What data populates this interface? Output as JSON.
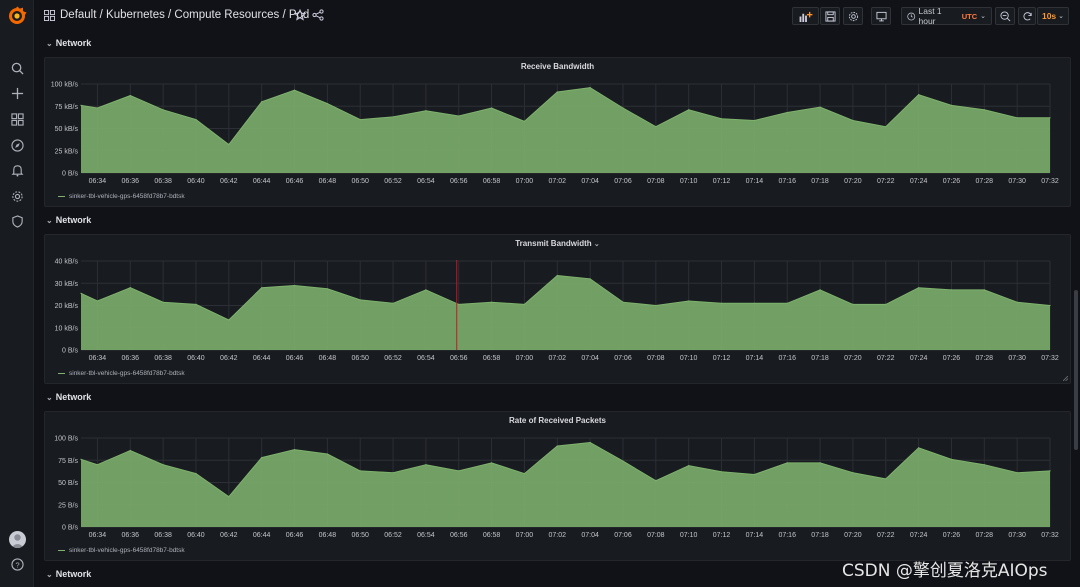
{
  "nav": {
    "breadcrumb": "Default / Kubernetes / Compute Resources / Pod"
  },
  "sidebar": {
    "items": [
      "search-icon",
      "plus-icon",
      "dashboards-icon",
      "explore-icon",
      "alerting-icon",
      "configuration-icon",
      "shield-icon"
    ],
    "bottom": [
      "user-avatar",
      "help-icon"
    ]
  },
  "toolbar": {
    "time_range": "Last 1 hour",
    "timezone": "UTC",
    "refresh_interval": "10s"
  },
  "rows": [
    {
      "title": "Network"
    },
    {
      "title": "Network"
    },
    {
      "title": "Network"
    },
    {
      "title": "Network"
    }
  ],
  "panels": [
    {
      "title": "Receive Bandwidth",
      "legend": "sinker-tbl-vehicle-gps-6458fd78b7-bdtsk",
      "y_ticks": [
        "100 kB/s",
        "75 kB/s",
        "50 kB/s",
        "25 kB/s",
        "0 B/s"
      ]
    },
    {
      "title": "Transmit Bandwidth",
      "legend": "sinker-tbl-vehicle-gps-6458fd78b7-bdtsk",
      "y_ticks": [
        "40 kB/s",
        "30 kB/s",
        "20 kB/s",
        "10 kB/s",
        "0 B/s"
      ]
    },
    {
      "title": "Rate of Received Packets",
      "legend": "sinker-tbl-vehicle-gps-6458fd78b7-bdtsk",
      "y_ticks": [
        "100 B/s",
        "75 B/s",
        "50 B/s",
        "25 B/s",
        "0 B/s"
      ]
    }
  ],
  "colors": {
    "series_fill": "#7eb26d",
    "cursor_line": "#c4162a",
    "timezone": "#ff7941",
    "refresh": "#ff9830"
  },
  "chart_data": [
    {
      "type": "area",
      "title": "Receive Bandwidth",
      "x": [
        "06:33",
        "06:34",
        "06:36",
        "06:38",
        "06:40",
        "06:42",
        "06:44",
        "06:46",
        "06:48",
        "06:50",
        "06:52",
        "06:54",
        "06:56",
        "06:58",
        "07:00",
        "07:02",
        "07:04",
        "07:06",
        "07:08",
        "07:10",
        "07:12",
        "07:14",
        "07:16",
        "07:18",
        "07:20",
        "07:22",
        "07:24",
        "07:26",
        "07:28",
        "07:30",
        "07:32"
      ],
      "x_ticks": [
        "06:34",
        "06:36",
        "06:38",
        "06:40",
        "06:42",
        "06:44",
        "06:46",
        "06:48",
        "06:50",
        "06:52",
        "06:54",
        "06:56",
        "06:58",
        "07:00",
        "07:02",
        "07:04",
        "07:06",
        "07:08",
        "07:10",
        "07:12",
        "07:14",
        "07:16",
        "07:18",
        "07:20",
        "07:22",
        "07:24",
        "07:26",
        "07:28",
        "07:30",
        "07:32"
      ],
      "series": [
        {
          "name": "sinker-tbl-vehicle-gps-6458fd78b7-bdtsk",
          "values": [
            76,
            73,
            87,
            71,
            60,
            32,
            80,
            93,
            78,
            60,
            63,
            70,
            64,
            73,
            58,
            91,
            96,
            73,
            52,
            71,
            61,
            59,
            68,
            74,
            59,
            52,
            88,
            76,
            71,
            62,
            62
          ]
        }
      ],
      "ylim": [
        0,
        100
      ],
      "y_unit": "kB/s"
    },
    {
      "type": "area",
      "title": "Transmit Bandwidth",
      "x": [
        "06:33",
        "06:34",
        "06:36",
        "06:38",
        "06:40",
        "06:42",
        "06:44",
        "06:46",
        "06:48",
        "06:50",
        "06:52",
        "06:54",
        "06:56",
        "06:58",
        "07:00",
        "07:02",
        "07:04",
        "07:06",
        "07:08",
        "07:10",
        "07:12",
        "07:14",
        "07:16",
        "07:18",
        "07:20",
        "07:22",
        "07:24",
        "07:26",
        "07:28",
        "07:30",
        "07:32"
      ],
      "x_ticks": [
        "06:34",
        "06:36",
        "06:38",
        "06:40",
        "06:42",
        "06:44",
        "06:46",
        "06:48",
        "06:50",
        "06:52",
        "06:54",
        "06:56",
        "06:58",
        "07:00",
        "07:02",
        "07:04",
        "07:06",
        "07:08",
        "07:10",
        "07:12",
        "07:14",
        "07:16",
        "07:18",
        "07:20",
        "07:22",
        "07:24",
        "07:26",
        "07:28",
        "07:30",
        "07:32"
      ],
      "series": [
        {
          "name": "sinker-tbl-vehicle-gps-6458fd78b7-bdtsk",
          "values": [
            25.5,
            22,
            28,
            21.5,
            20.5,
            13.5,
            28,
            29,
            27.5,
            22.5,
            21,
            27,
            20.5,
            21.5,
            20.5,
            33.5,
            32,
            21.5,
            20,
            22,
            21,
            21,
            21,
            27,
            20.5,
            20.5,
            28,
            27,
            27,
            21.5,
            20
          ]
        }
      ],
      "ylim": [
        0,
        40
      ],
      "y_unit": "kB/s",
      "cursor_time": "06:56"
    },
    {
      "type": "area",
      "title": "Rate of Received Packets",
      "x": [
        "06:33",
        "06:34",
        "06:36",
        "06:38",
        "06:40",
        "06:42",
        "06:44",
        "06:46",
        "06:48",
        "06:50",
        "06:52",
        "06:54",
        "06:56",
        "06:58",
        "07:00",
        "07:02",
        "07:04",
        "07:06",
        "07:08",
        "07:10",
        "07:12",
        "07:14",
        "07:16",
        "07:18",
        "07:20",
        "07:22",
        "07:24",
        "07:26",
        "07:28",
        "07:30",
        "07:32"
      ],
      "x_ticks": [
        "06:34",
        "06:36",
        "06:38",
        "06:40",
        "06:42",
        "06:44",
        "06:46",
        "06:48",
        "06:50",
        "06:52",
        "06:54",
        "06:56",
        "06:58",
        "07:00",
        "07:02",
        "07:04",
        "07:06",
        "07:08",
        "07:10",
        "07:12",
        "07:14",
        "07:16",
        "07:18",
        "07:20",
        "07:22",
        "07:24",
        "07:26",
        "07:28",
        "07:30",
        "07:32"
      ],
      "series": [
        {
          "name": "sinker-tbl-vehicle-gps-6458fd78b7-bdtsk",
          "values": [
            76,
            70,
            86,
            70,
            60,
            34,
            78,
            87,
            82,
            63,
            61,
            70,
            63,
            72,
            60,
            91,
            95,
            74,
            52,
            69,
            62,
            59,
            72,
            72,
            61,
            54,
            89,
            76,
            70,
            61,
            63
          ]
        }
      ],
      "ylim": [
        0,
        100
      ],
      "y_unit": "B/s"
    }
  ],
  "watermark": "CSDN @擎创夏洛克AIOps"
}
